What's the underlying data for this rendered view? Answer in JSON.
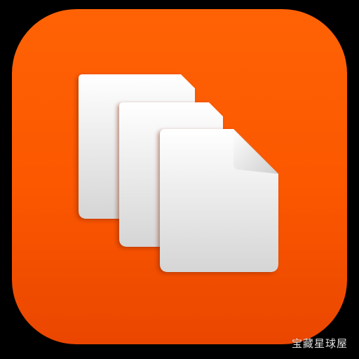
{
  "icon": {
    "name": "files-stack-icon",
    "background_top": "#ff5f00",
    "background_bottom": "#f04a00",
    "sheet_top": "#ffffff",
    "sheet_bottom": "#d4d4d4"
  },
  "watermark": {
    "text": "宝藏星球屋"
  }
}
